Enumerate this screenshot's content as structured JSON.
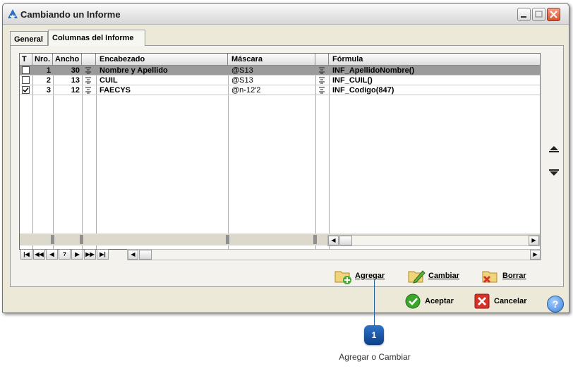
{
  "window": {
    "title": "Cambiando un Informe"
  },
  "tabs": [
    {
      "label": "General"
    },
    {
      "label": "Columnas del Informe"
    }
  ],
  "grid": {
    "headers": {
      "t": "T",
      "nro": "Nro.",
      "ancho": "Ancho",
      "encabezado": "Encabezado",
      "mascara": "Máscara",
      "formula": "Fórmula"
    },
    "rows": [
      {
        "checked": false,
        "nro": "1",
        "ancho": "30",
        "encabezado": "Nombre y Apellido",
        "mascara": "@S13",
        "formula": "INF_ApellidoNombre()"
      },
      {
        "checked": false,
        "nro": "2",
        "ancho": "13",
        "encabezado": "CUIL",
        "mascara": "@S13",
        "formula": "INF_CUIL()"
      },
      {
        "checked": true,
        "nro": "3",
        "ancho": "12",
        "encabezado": "FAECYS",
        "mascara": "@n-12'2",
        "formula": "INF_Codigo(847)"
      }
    ]
  },
  "navigator": [
    "|◀",
    "◀◀",
    "◀",
    "?",
    "▶",
    "▶▶",
    "▶|"
  ],
  "actions": {
    "agregar": "Agregar",
    "cambiar": "Cambiar",
    "borrar": "Borrar"
  },
  "footer": {
    "aceptar": "Aceptar",
    "cancelar": "Cancelar",
    "help": "?"
  },
  "callout": {
    "number": "1",
    "label": "Agregar o Cambiar"
  },
  "colors": {
    "selected_row": "#9b9b9b",
    "callout": "#0d3f86",
    "accent": "#1f5fa0"
  },
  "icons": [
    "app-logo-icon",
    "minimize-icon",
    "maximize-icon",
    "close-icon",
    "move-up-icon",
    "move-down-icon",
    "add-folder-icon",
    "edit-pencil-icon",
    "delete-folder-icon",
    "accept-check-icon",
    "cancel-x-icon",
    "help-icon"
  ]
}
